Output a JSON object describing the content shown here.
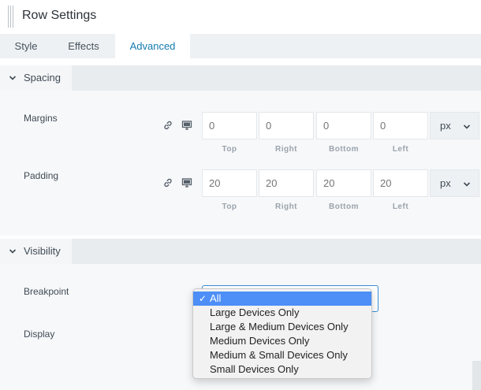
{
  "header": {
    "title": "Row Settings"
  },
  "tabs": [
    {
      "label": "Style"
    },
    {
      "label": "Effects"
    },
    {
      "label": "Advanced",
      "active": true
    }
  ],
  "spacing": {
    "title": "Spacing",
    "margins": {
      "label": "Margins",
      "values": [
        "0",
        "0",
        "0",
        "0"
      ],
      "unit": "px"
    },
    "padding": {
      "label": "Padding",
      "values": [
        "20",
        "20",
        "20",
        "20"
      ],
      "unit": "px"
    },
    "sides": [
      "Top",
      "Right",
      "Bottom",
      "Left"
    ]
  },
  "visibility": {
    "title": "Visibility",
    "breakpoint_label": "Breakpoint",
    "display_label": "Display",
    "options": [
      "All",
      "Large Devices Only",
      "Large & Medium Devices Only",
      "Medium Devices Only",
      "Medium & Small Devices Only",
      "Small Devices Only"
    ],
    "selected": "All",
    "check": "✓"
  },
  "colors": {
    "accent": "#147bb0",
    "selection": "#4d8ef7",
    "focus": "#3b8fd9"
  },
  "icons": [
    "link-icon",
    "desktop-icon",
    "chevron-down-icon",
    "checkmark-icon"
  ]
}
